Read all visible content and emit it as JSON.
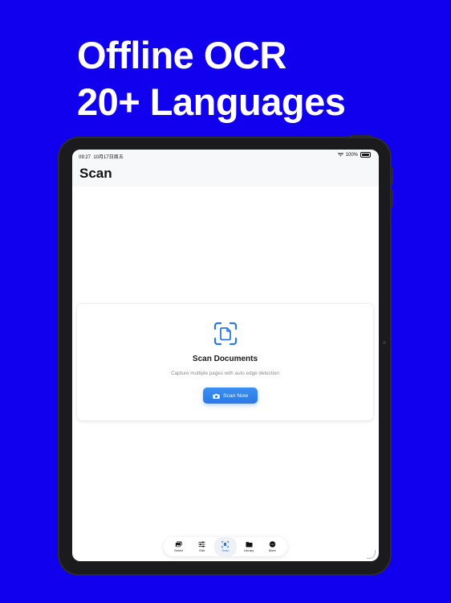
{
  "headline": {
    "line1": "Offline OCR",
    "line2": "20+ Languages"
  },
  "statusbar": {
    "time": "09:27",
    "date": "10月17日周五",
    "battery": "100%"
  },
  "nav": {
    "title": "Scan"
  },
  "card": {
    "icon": "document-scan-icon",
    "title": "Scan Documents",
    "subtitle": "Capture multiple pages with auto edge detection",
    "button_label": "Scan Now",
    "button_icon": "camera-icon"
  },
  "tabs": [
    {
      "label": "Select",
      "icon": "photos-icon",
      "active": false
    },
    {
      "label": "Edit",
      "icon": "sliders-icon",
      "active": false
    },
    {
      "label": "Scan",
      "icon": "document-scan-icon",
      "active": true
    },
    {
      "label": "Library",
      "icon": "folder-icon",
      "active": false
    },
    {
      "label": "More",
      "icon": "ellipsis-circle-icon",
      "active": false
    }
  ],
  "colors": {
    "background": "#1000ee",
    "accent": "#2a78e6",
    "device": "#1b1b1d"
  }
}
